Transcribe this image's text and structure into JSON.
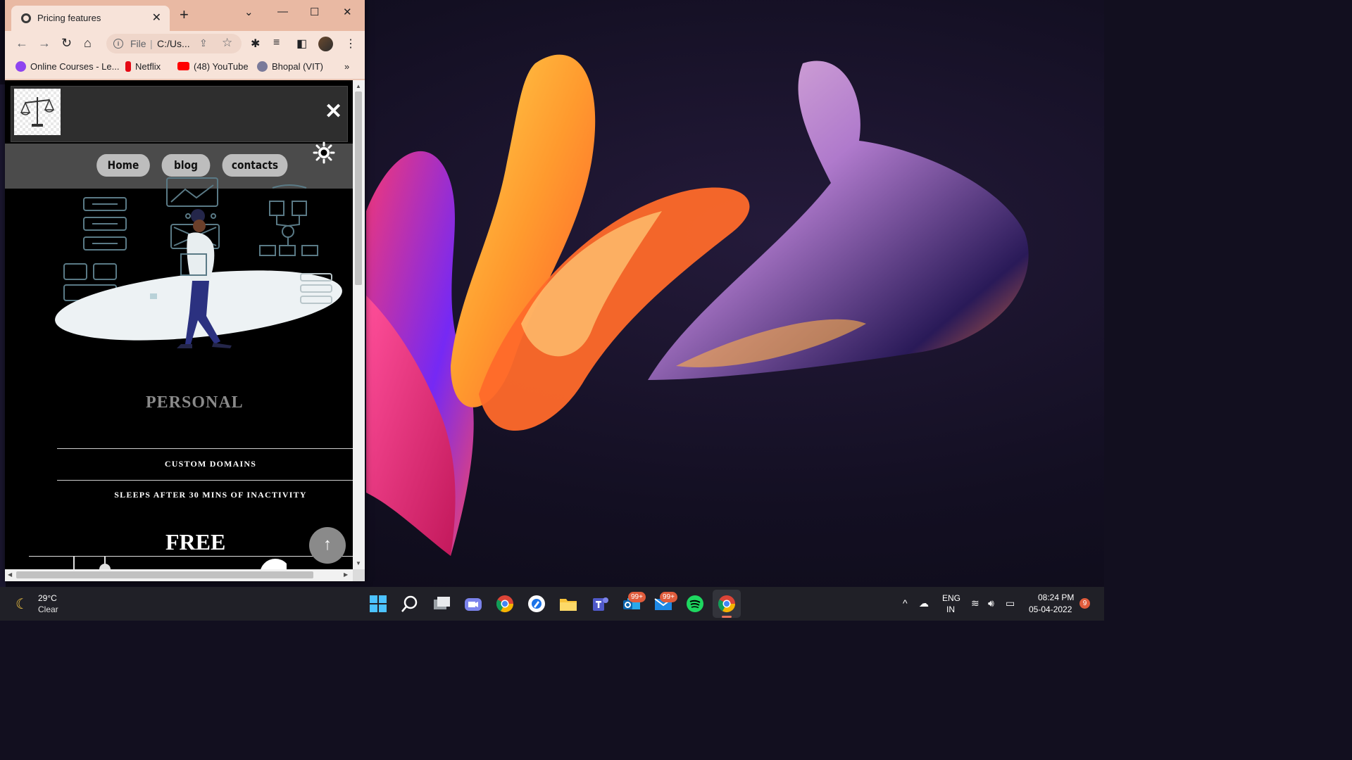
{
  "browser": {
    "tab_title": "Pricing features",
    "newtab_icon": "+",
    "window_controls": [
      "⌄",
      "—",
      "☐",
      "✕"
    ],
    "omnibox": {
      "scheme": "File",
      "separator": "|",
      "url": "C:/Us..."
    },
    "bookmarks": [
      {
        "label": "Online Courses - Le...",
        "color": "#8e44f0"
      },
      {
        "label": "Netflix",
        "color": "#e50914"
      },
      {
        "label": "(48) YouTube",
        "color": "#ff0000"
      },
      {
        "label": "Bhopal (VIT)",
        "color": "#7a7a9a"
      }
    ],
    "bookmarks_more": "»"
  },
  "site": {
    "nav": [
      "Home",
      "blog",
      "contacts"
    ],
    "plan": {
      "title": "PERSONAL",
      "features": [
        "CUSTOM DOMAINS",
        "SLEEPS AFTER 30 MINS OF INACTIVITY"
      ],
      "price": "FREE"
    },
    "close_icon": "✕",
    "scroll_top_icon": "↑"
  },
  "taskbar": {
    "weather": {
      "temp": "29°C",
      "desc": "Clear"
    },
    "badges": [
      "99+",
      "99+"
    ],
    "lang": [
      "ENG",
      "IN"
    ],
    "time": "08:24 PM",
    "date": "05-04-2022",
    "notification_count": "9"
  },
  "colors": {
    "titlebar": "#e9b9a3",
    "toolbar": "#f7e3d9",
    "page_bg": "#000000",
    "nav_bar": "#4b4b4b",
    "nav_button": "#bdbdbd",
    "taskbar": "#202027"
  }
}
